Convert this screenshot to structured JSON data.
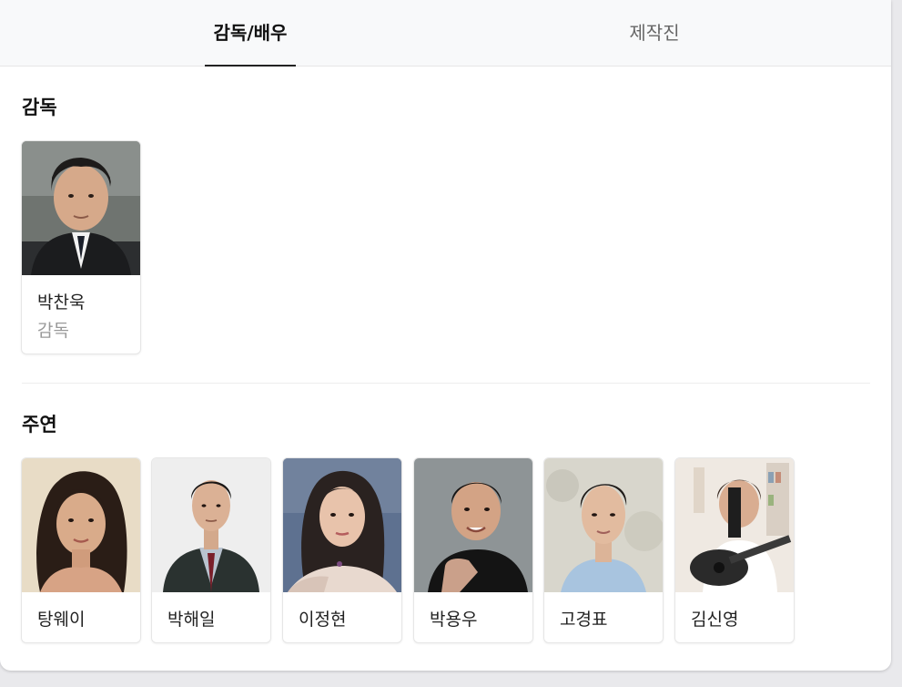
{
  "tabs": [
    {
      "label": "감독/배우",
      "active": true
    },
    {
      "label": "제작진",
      "active": false
    }
  ],
  "sections": {
    "director": {
      "title": "감독",
      "people": [
        {
          "name": "박찬욱",
          "role": "감독"
        }
      ]
    },
    "lead": {
      "title": "주연",
      "people": [
        {
          "name": "탕웨이"
        },
        {
          "name": "박해일"
        },
        {
          "name": "이정현"
        },
        {
          "name": "박용우"
        },
        {
          "name": "고경표"
        },
        {
          "name": "김신영"
        }
      ]
    }
  }
}
